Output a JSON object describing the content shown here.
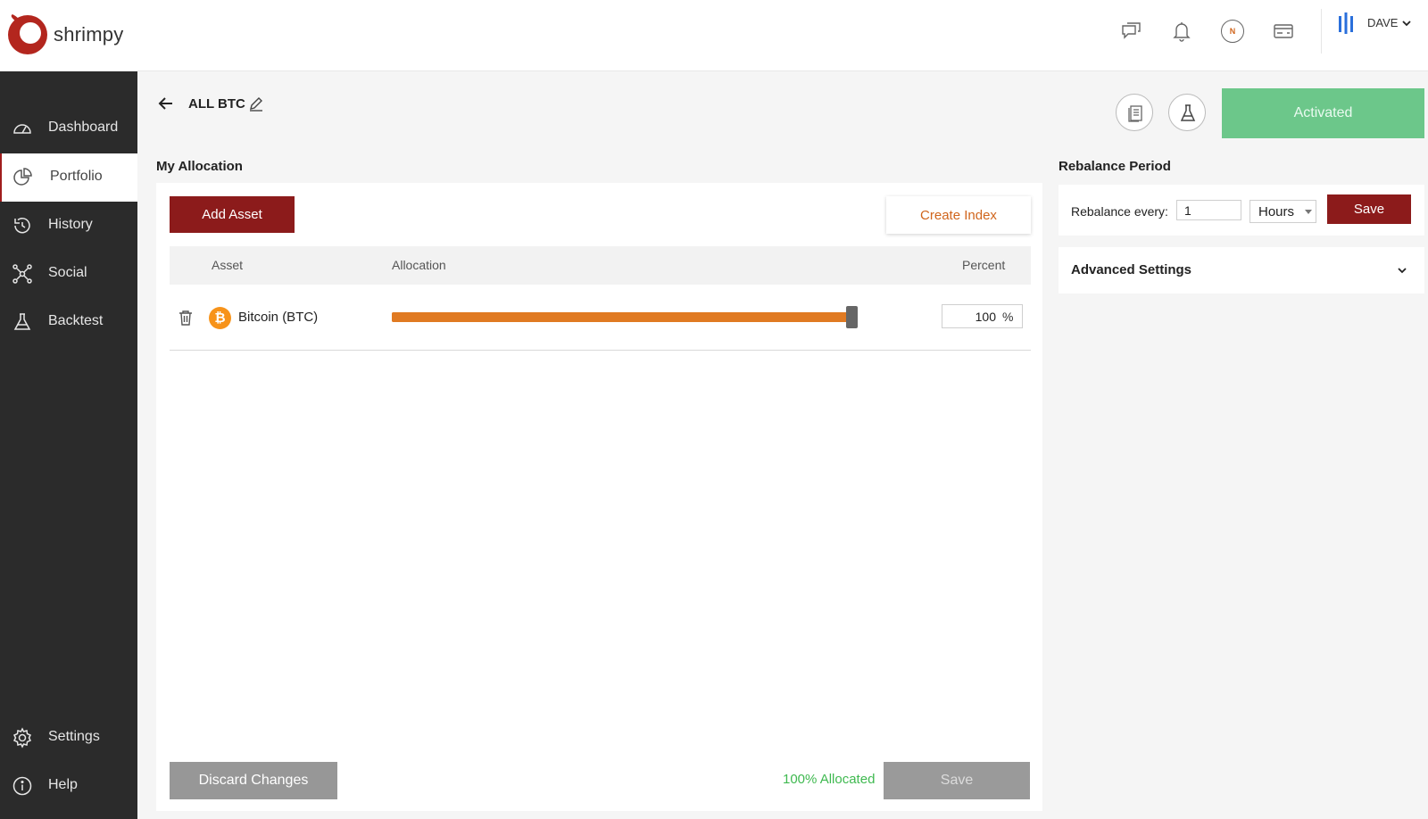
{
  "app": {
    "logo_text": "shrimpy"
  },
  "sidebar": {
    "items": [
      {
        "label": "Dashboard",
        "icon": "dashboard-gauge-icon"
      },
      {
        "label": "Portfolio",
        "icon": "pie-chart-icon",
        "active": true
      },
      {
        "label": "History",
        "icon": "history-clock-icon"
      },
      {
        "label": "Social",
        "icon": "social-network-icon"
      },
      {
        "label": "Backtest",
        "icon": "flask-icon"
      }
    ],
    "bottom_items": [
      {
        "label": "Settings",
        "icon": "gear-icon"
      },
      {
        "label": "Help",
        "icon": "info-icon"
      }
    ]
  },
  "topbar": {
    "icons": [
      "chat-icon",
      "bell-icon",
      "news-icon",
      "card-icon"
    ],
    "news_letter": "N",
    "user_name": "DAVE"
  },
  "portfolio": {
    "title": "ALL BTC",
    "status_button": "Activated"
  },
  "allocation": {
    "section_title": "My Allocation",
    "add_asset_label": "Add Asset",
    "create_index_label": "Create Index",
    "columns": {
      "asset": "Asset",
      "allocation": "Allocation",
      "percent": "Percent"
    },
    "rows": [
      {
        "asset": "Bitcoin (BTC)",
        "symbol_glyph": "₿",
        "percent": "100",
        "allocation_fraction": 1.0
      }
    ],
    "percent_sign": "%",
    "discard_label": "Discard Changes",
    "allocated_text": "100% Allocated",
    "save_label": "Save"
  },
  "rebalance": {
    "section_title": "Rebalance Period",
    "label": "Rebalance every:",
    "value": "1",
    "unit": "Hours",
    "save_label": "Save",
    "advanced_label": "Advanced Settings"
  },
  "colors": {
    "brand_red": "#8c1b1b",
    "activated_green": "#6cc78a",
    "slider_orange": "#e07a22",
    "allocated_green": "#3fb950",
    "sidebar_bg": "#2b2b2b"
  }
}
